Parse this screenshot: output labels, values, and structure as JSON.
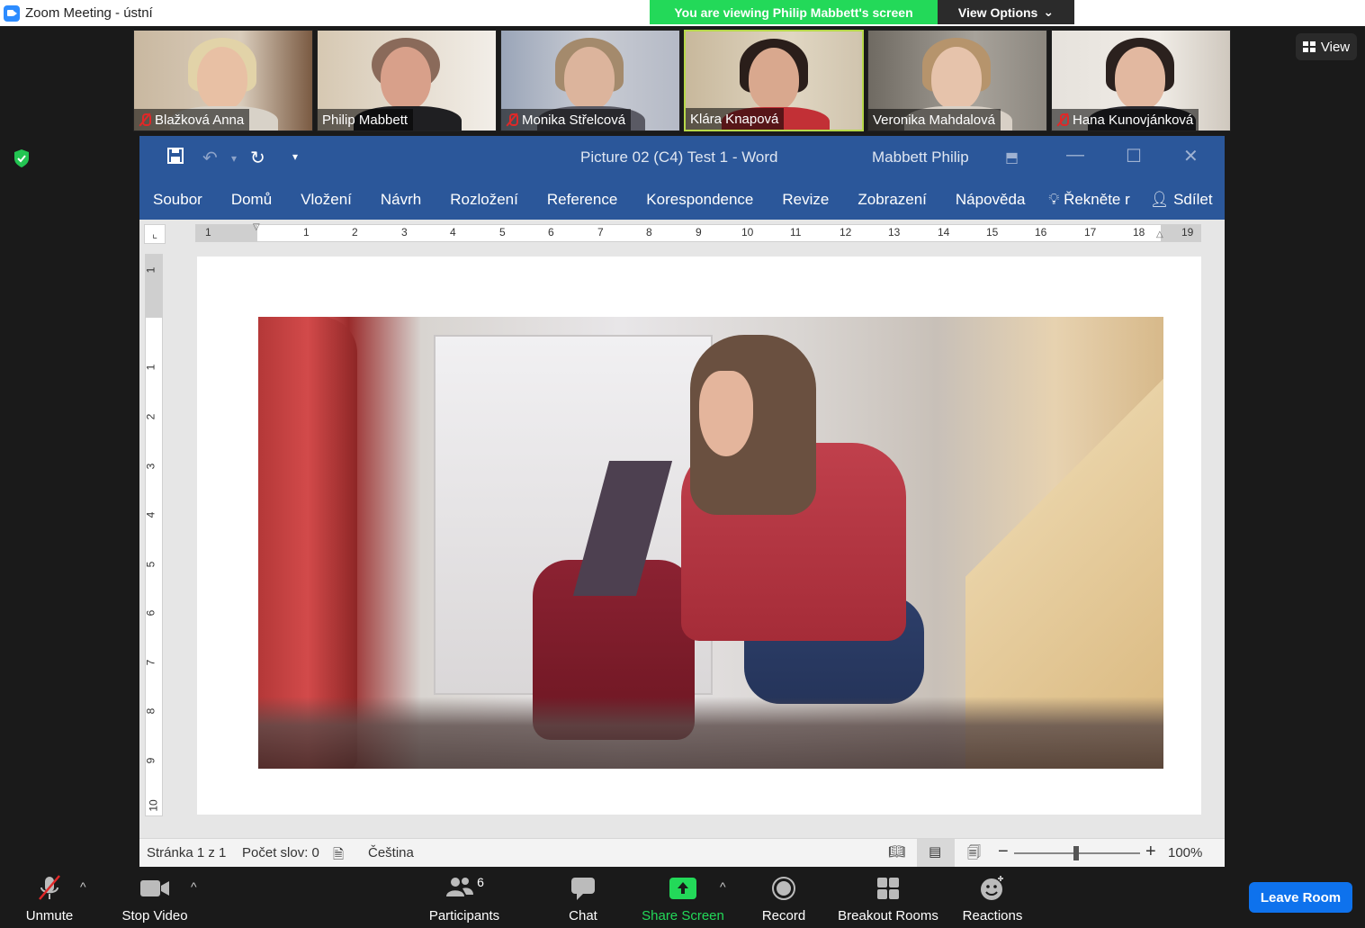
{
  "window": {
    "title": "Zoom Meeting - ústní"
  },
  "banner": {
    "viewing": "You are viewing Philip Mabbett's screen",
    "view_options": "View Options"
  },
  "view_button": "View",
  "participants": [
    {
      "name": "Blažková Anna",
      "muted": true
    },
    {
      "name": "Philip Mabbett",
      "muted": false
    },
    {
      "name": "Monika Střelcová",
      "muted": true
    },
    {
      "name": "Klára Knapová",
      "muted": false
    },
    {
      "name": "Veronika Mahdalová",
      "muted": false
    },
    {
      "name": "Hana Kunovjánková",
      "muted": true
    }
  ],
  "word": {
    "doc_title": "Picture 02 (C4) Test 1  -  Word",
    "user": "Mabbett Philip",
    "tabs": [
      "Soubor",
      "Domů",
      "Vložení",
      "Návrh",
      "Rozložení",
      "Reference",
      "Korespondence",
      "Revize",
      "Zobrazení",
      "Nápověda",
      "Řekněte r",
      "Sdílet"
    ],
    "ruler_h": [
      "1",
      "1",
      "2",
      "3",
      "4",
      "5",
      "6",
      "7",
      "8",
      "9",
      "10",
      "11",
      "12",
      "13",
      "14",
      "15",
      "16",
      "17",
      "18",
      "19"
    ],
    "ruler_v": [
      "1",
      "1",
      "2",
      "3",
      "4",
      "5",
      "6",
      "7",
      "8",
      "9",
      "10"
    ],
    "status": {
      "page": "Stránka 1 z 1",
      "words": "Počet slov: 0",
      "language": "Čeština",
      "zoom": "100%"
    }
  },
  "toolbar": {
    "unmute": "Unmute",
    "stop_video": "Stop Video",
    "participants": "Participants",
    "participants_count": "6",
    "chat": "Chat",
    "share_screen": "Share Screen",
    "record": "Record",
    "breakout_rooms": "Breakout Rooms",
    "reactions": "Reactions",
    "leave": "Leave Room"
  }
}
